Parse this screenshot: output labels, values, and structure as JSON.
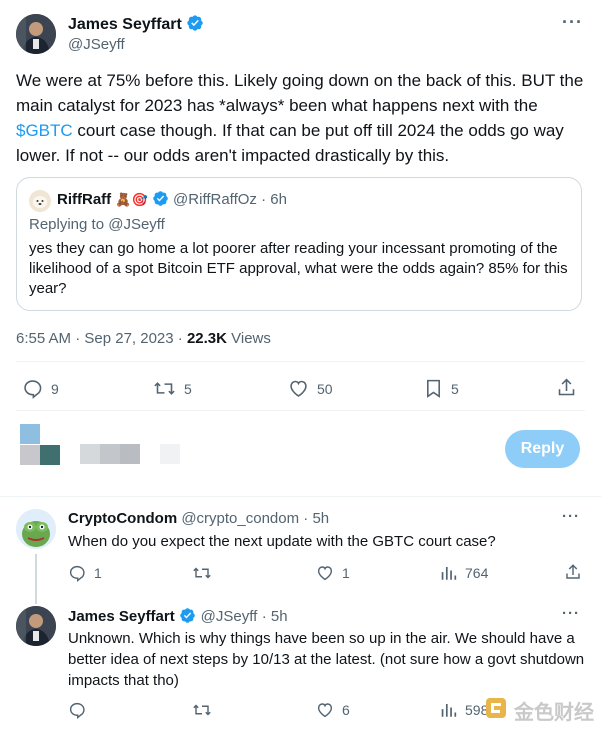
{
  "main_tweet": {
    "author_name": "James Seyffart",
    "author_handle": "@JSeyff",
    "text_pre": "We were at 75% before this. Likely going down on the back of this. BUT the main catalyst for 2023 has *always* been what happens next with the ",
    "cashtag": "$GBTC",
    "text_post": " court case though. If that can be put off till 2024 the odds go way lower. If not -- our odds aren't impacted drastically by this.",
    "time": "6:55 AM · Sep 27, 2023 · ",
    "views_count": "22.3K",
    "views_label": " Views",
    "stats": {
      "replies": "9",
      "retweets": "5",
      "likes": "50",
      "bookmarks": "5"
    }
  },
  "quoted_tweet": {
    "author_name": "RiffRaff",
    "emojis": "🧸🎯",
    "author_handle": "@RiffRaffOz",
    "time": "· 6h",
    "replying_to": "Replying to @JSeyff",
    "text": "yes they can go home a lot poorer after reading your incessant promoting of the likelihood of a spot Bitcoin ETF approval, what were the odds again? 85% for this year?"
  },
  "composer": {
    "reply_button": "Reply"
  },
  "replies": [
    {
      "author_name": "CryptoCondom",
      "author_handle": "@crypto_condom",
      "time": "· 5h",
      "text": "When do you expect the next update with the GBTC court case?",
      "stats": {
        "replies": "1",
        "retweets": "",
        "likes": "1",
        "views": "764"
      }
    },
    {
      "author_name": "James Seyffart",
      "author_handle": "@JSeyff",
      "time": "· 5h",
      "text": "Unknown. Which is why things have been so up in the air. We should have a better idea of next steps by 10/13 at the latest. (not sure how a govt shutdown impacts that tho)",
      "stats": {
        "replies": "",
        "retweets": "",
        "likes": "6",
        "views": "598"
      }
    }
  ],
  "watermark": "金色财经",
  "colors": {
    "accent": "#1d9bf0",
    "secondary_text": "#536471",
    "border": "#cfd9de"
  }
}
